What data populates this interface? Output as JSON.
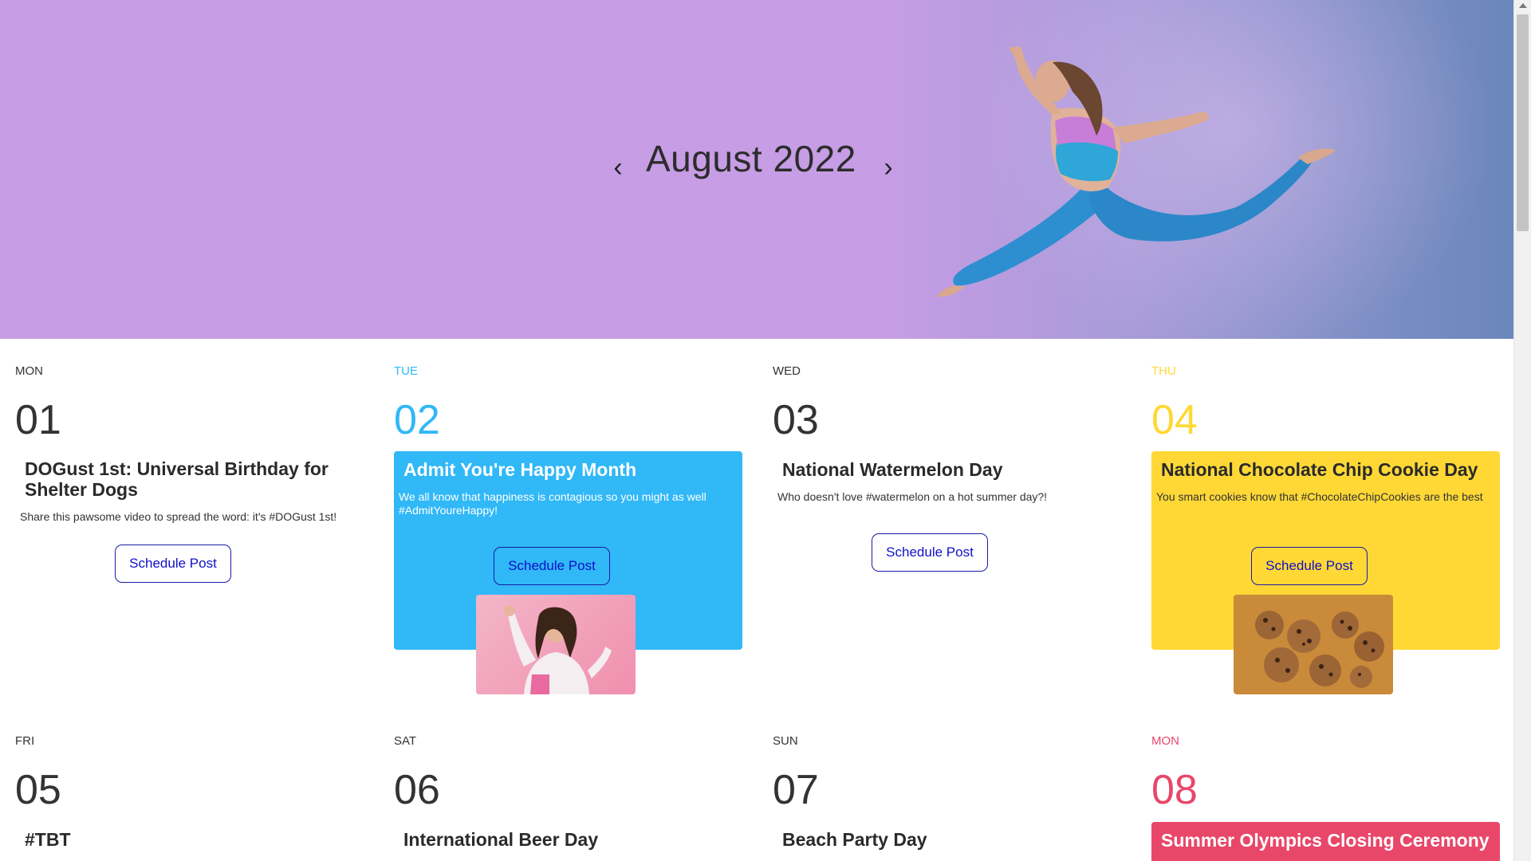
{
  "header": {
    "title": "August 2022",
    "prev_label": "‹",
    "next_label": "›"
  },
  "colors": {
    "accent_blue": "#30b8f7",
    "accent_yellow": "#ffd836",
    "accent_pink": "#e8476a",
    "button_text": "#1010c8"
  },
  "days": [
    {
      "weekday": "MON",
      "number": "01",
      "title": "DOGust 1st: Universal Birthday for Shelter Dogs",
      "description": "Share this pawsome video to spread the word: it's #DOGust 1st!",
      "button": "Schedule Post"
    },
    {
      "weekday": "TUE",
      "number": "02",
      "title": "Admit You're Happy Month",
      "description": "We all know that happiness is contagious so you might as well #AdmitYoureHappy!",
      "button": "Schedule Post",
      "image": "smiling-woman-photo"
    },
    {
      "weekday": "WED",
      "number": "03",
      "title": "National Watermelon Day",
      "description": "Who doesn't love #watermelon on a hot summer day?!",
      "button": "Schedule Post"
    },
    {
      "weekday": "THU",
      "number": "04",
      "title": "National Chocolate Chip Cookie Day",
      "description": "You smart cookies know that #ChocolateChipCookies are the best",
      "button": "Schedule Post",
      "image": "cookies-photo"
    },
    {
      "weekday": "FRI",
      "number": "05",
      "title": "#TBT"
    },
    {
      "weekday": "SAT",
      "number": "06",
      "title": "International Beer Day"
    },
    {
      "weekday": "SUN",
      "number": "07",
      "title": "Beach Party Day"
    },
    {
      "weekday": "MON",
      "number": "08",
      "title": "Summer Olympics Closing Ceremony"
    }
  ]
}
